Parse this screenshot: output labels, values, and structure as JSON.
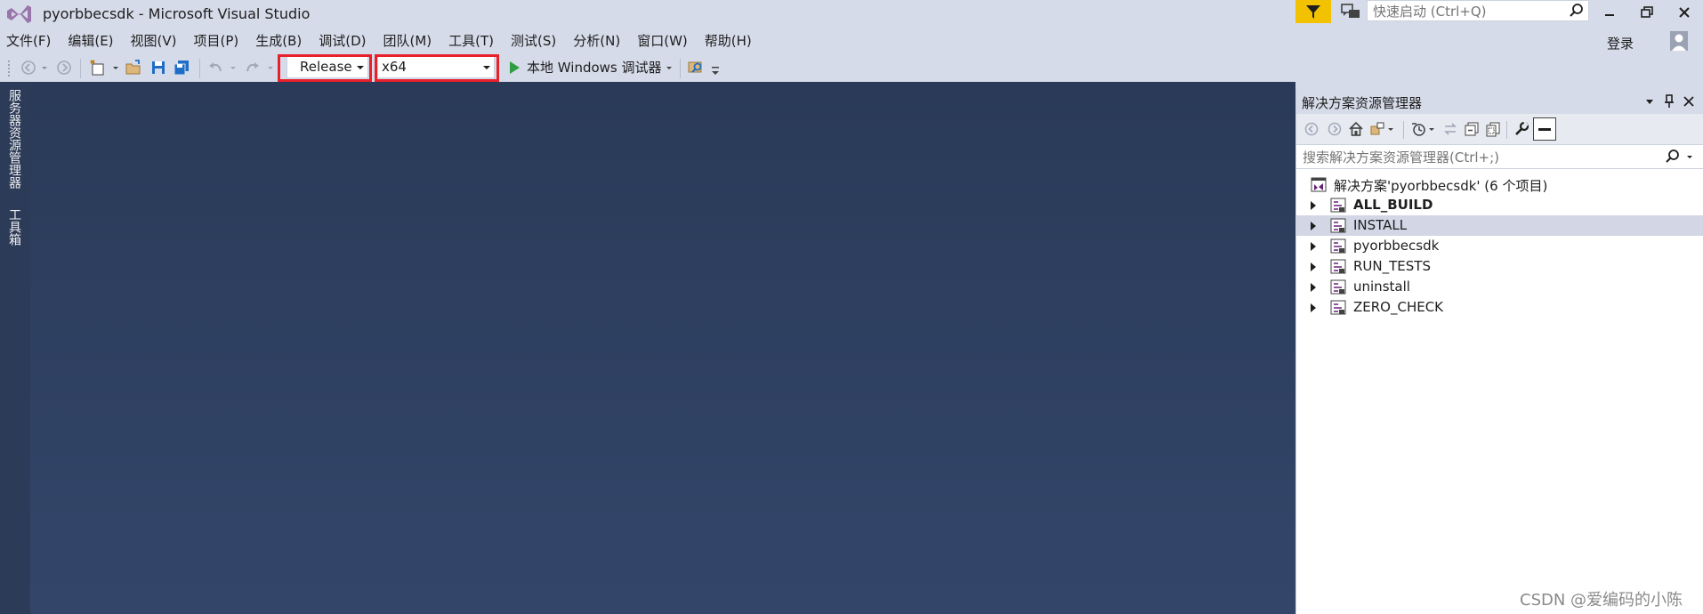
{
  "window": {
    "title": "pyorbbecsdk - Microsoft Visual Studio",
    "quick_launch_placeholder": "快速启动 (Ctrl+Q)"
  },
  "menu": {
    "items": [
      "文件(F)",
      "编辑(E)",
      "视图(V)",
      "项目(P)",
      "生成(B)",
      "调试(D)",
      "团队(M)",
      "工具(T)",
      "测试(S)",
      "分析(N)",
      "窗口(W)",
      "帮助(H)"
    ],
    "login": "登录"
  },
  "toolbar": {
    "configuration": "Release",
    "platform": "x64",
    "run_label": "本地 Windows 调试器"
  },
  "left_tabs": {
    "server_explorer": "服务器资源管理器",
    "toolbox": "工具箱"
  },
  "solution_explorer": {
    "title": "解决方案资源管理器",
    "search_placeholder": "搜索解决方案资源管理器(Ctrl+;)",
    "solution_label": "解决方案'pyorbbecsdk' (6 个项目)",
    "projects": [
      {
        "name": "ALL_BUILD",
        "bold": true,
        "selected": false
      },
      {
        "name": "INSTALL",
        "bold": false,
        "selected": true
      },
      {
        "name": "pyorbbecsdk",
        "bold": false,
        "selected": false
      },
      {
        "name": "RUN_TESTS",
        "bold": false,
        "selected": false
      },
      {
        "name": "uninstall",
        "bold": false,
        "selected": false
      },
      {
        "name": "ZERO_CHECK",
        "bold": false,
        "selected": false
      }
    ]
  },
  "watermark": "CSDN @爱编码的小陈",
  "colors": {
    "chrome": "#d6dbe9",
    "editor": "#2f4163",
    "highlight_box": "#e8202a",
    "filter_button": "#f2c200",
    "run_green": "#2e9e43"
  }
}
